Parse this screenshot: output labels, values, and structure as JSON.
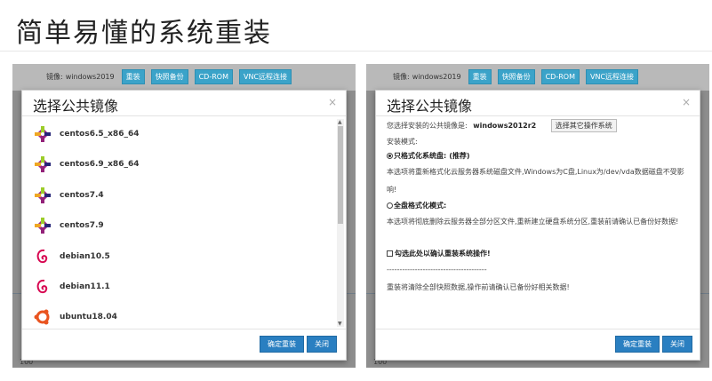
{
  "page": {
    "title": "简单易懂的系统重装"
  },
  "toolbar": {
    "image_label": "镜像:",
    "image_value": "windows2019",
    "buttons": [
      "重装",
      "快照备份",
      "CD-ROM",
      "VNC远程连接"
    ]
  },
  "left_modal": {
    "title": "选择公共镜像",
    "close": "×",
    "images": [
      {
        "name": "centos6.5_x86_64",
        "icon": "centos-icon"
      },
      {
        "name": "centos6.9_x86_64",
        "icon": "centos-icon"
      },
      {
        "name": "centos7.4",
        "icon": "centos-icon"
      },
      {
        "name": "centos7.9",
        "icon": "centos-icon"
      },
      {
        "name": "debian10.5",
        "icon": "debian-icon"
      },
      {
        "name": "debian11.1",
        "icon": "debian-icon"
      },
      {
        "name": "ubuntu18.04",
        "icon": "ubuntu-icon"
      }
    ],
    "confirm": "确定重装",
    "close_btn": "关闭"
  },
  "right_modal": {
    "title": "选择公共镜像",
    "close": "×",
    "selected_label": "您选择安装的公共镜像是:",
    "selected_value": "windows2012r2",
    "other_os_btn": "选择其它操作系统",
    "mode_label": "安装模式:",
    "mode1_label": "只格式化系统盘:",
    "mode1_tag": "(推荐)",
    "mode1_desc_1": "本选项将重新格式化云服务器系统磁盘文件,Windows为C盘,Linux为/dev/vda数据磁盘不受影",
    "mode1_desc_2": "响!",
    "mode2_label": "全盘格式化模式:",
    "mode2_desc": "本选项将彻底删除云服务器全部分区文件,重新建立硬盘系统分区,重装前请确认已备份好数据!",
    "confirm_check": "勾选此处以确认重装系统操作!",
    "separator": "---------------------------------------",
    "warning": "重装将清除全部快照数据,操作前请确认已备份好相关数据!",
    "confirm": "确定重装",
    "close_btn": "关闭"
  },
  "background": {
    "tick": "100"
  },
  "colors": {
    "toolbar_button": "#3ba3c9",
    "primary_button": "#2a7fc1"
  }
}
